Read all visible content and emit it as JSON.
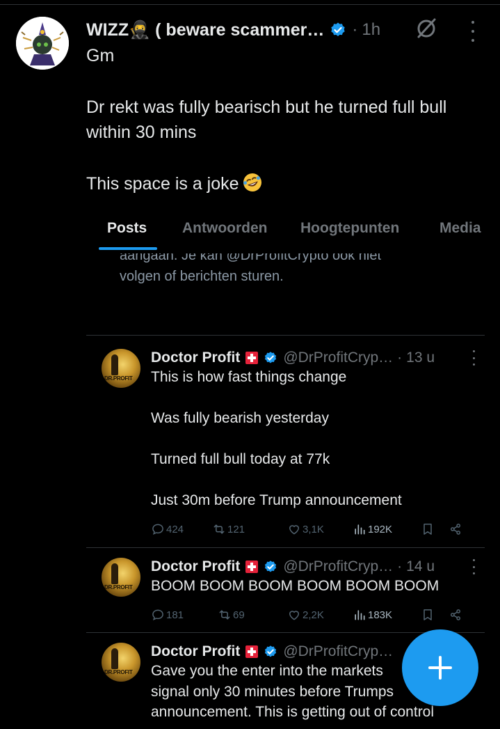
{
  "main_tweet": {
    "display_name": "WIZZ🥷 ( beware scammer…",
    "separator": "·",
    "time": "1h",
    "text_lines": [
      "Gm",
      "Dr rekt was fully bearisch but he turned full bull within 30 mins",
      "This space is a joke"
    ],
    "emoji": "rolling-on-floor-laughing"
  },
  "tabs": [
    "Posts",
    "Antwoorden",
    "Hoogtepunten",
    "Media"
  ],
  "active_tab": "Posts",
  "notice_lines": [
    "aangaan. Je kan @DrProfitCrypto ook niet",
    "volgen of berichten sturen."
  ],
  "avatar_brand": "DR.PROFIT",
  "tweets": [
    {
      "name": "Doctor Profit",
      "handle": "@DrProfitCryp…",
      "sep": "·",
      "time": "13 u",
      "body": [
        "This is how fast things change",
        "",
        "Was fully bearish yesterday",
        "",
        "Turned full bull today at 77k",
        "",
        "Just 30m before Trump announcement"
      ],
      "replies": "424",
      "reposts": "121",
      "likes": "3,1K",
      "views": "192K"
    },
    {
      "name": "Doctor Profit",
      "handle": "@DrProfitCryp…",
      "sep": "·",
      "time": "14 u",
      "body": [
        "BOOM BOOM BOOM BOOM BOOM BOOM"
      ],
      "replies": "181",
      "reposts": "69",
      "likes": "2,2K",
      "views": "183K"
    },
    {
      "name": "Doctor Profit",
      "handle": "@DrProfitCryp…",
      "sep": "",
      "time": "",
      "body": [
        "Gave you the enter into the markets",
        "signal only 30 minutes before Trumps",
        "announcement. This is getting out of control"
      ]
    }
  ],
  "colors": {
    "background": "#000000",
    "text": "#e7e9ea",
    "muted": "#71767b",
    "accent": "#1d9bf0",
    "verified": "#1d9bf0",
    "swiss_red": "#e5223a"
  }
}
